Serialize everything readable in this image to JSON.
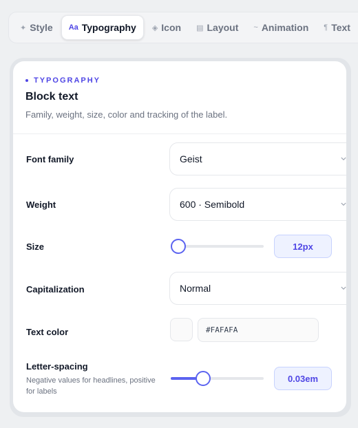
{
  "tabs": [
    {
      "icon": "✦",
      "label": "Style",
      "active": false
    },
    {
      "icon": "Aa",
      "label": "Typography",
      "active": true
    },
    {
      "icon": "◈",
      "label": "Icon",
      "active": false
    },
    {
      "icon": "▤",
      "label": "Layout",
      "active": false
    },
    {
      "icon": "~",
      "label": "Animation",
      "active": false
    },
    {
      "icon": "¶",
      "label": "Text",
      "active": false
    }
  ],
  "panel": {
    "eyebrow": "TYPOGRAPHY",
    "title": "Block text",
    "subtitle": "Family, weight, size, color and tracking of the label."
  },
  "fields": {
    "font_family": {
      "label": "Font family",
      "value": "Geist"
    },
    "weight": {
      "label": "Weight",
      "value": "600 · Semibold"
    },
    "size": {
      "label": "Size",
      "value": "12px",
      "slider_fraction": 0.0
    },
    "capitalization": {
      "label": "Capitalization",
      "value": "Normal"
    },
    "text_color": {
      "label": "Text color",
      "value": "#FAFAFA",
      "swatch": "#FAFAFA"
    },
    "letter_spacing": {
      "label": "Letter-spacing",
      "help": "Negative values for headlines, positive for labels",
      "value": "0.03em",
      "slider_fraction": 0.35
    }
  },
  "colors": {
    "accent": "#4F46E5",
    "slider": "#5B63F0"
  }
}
